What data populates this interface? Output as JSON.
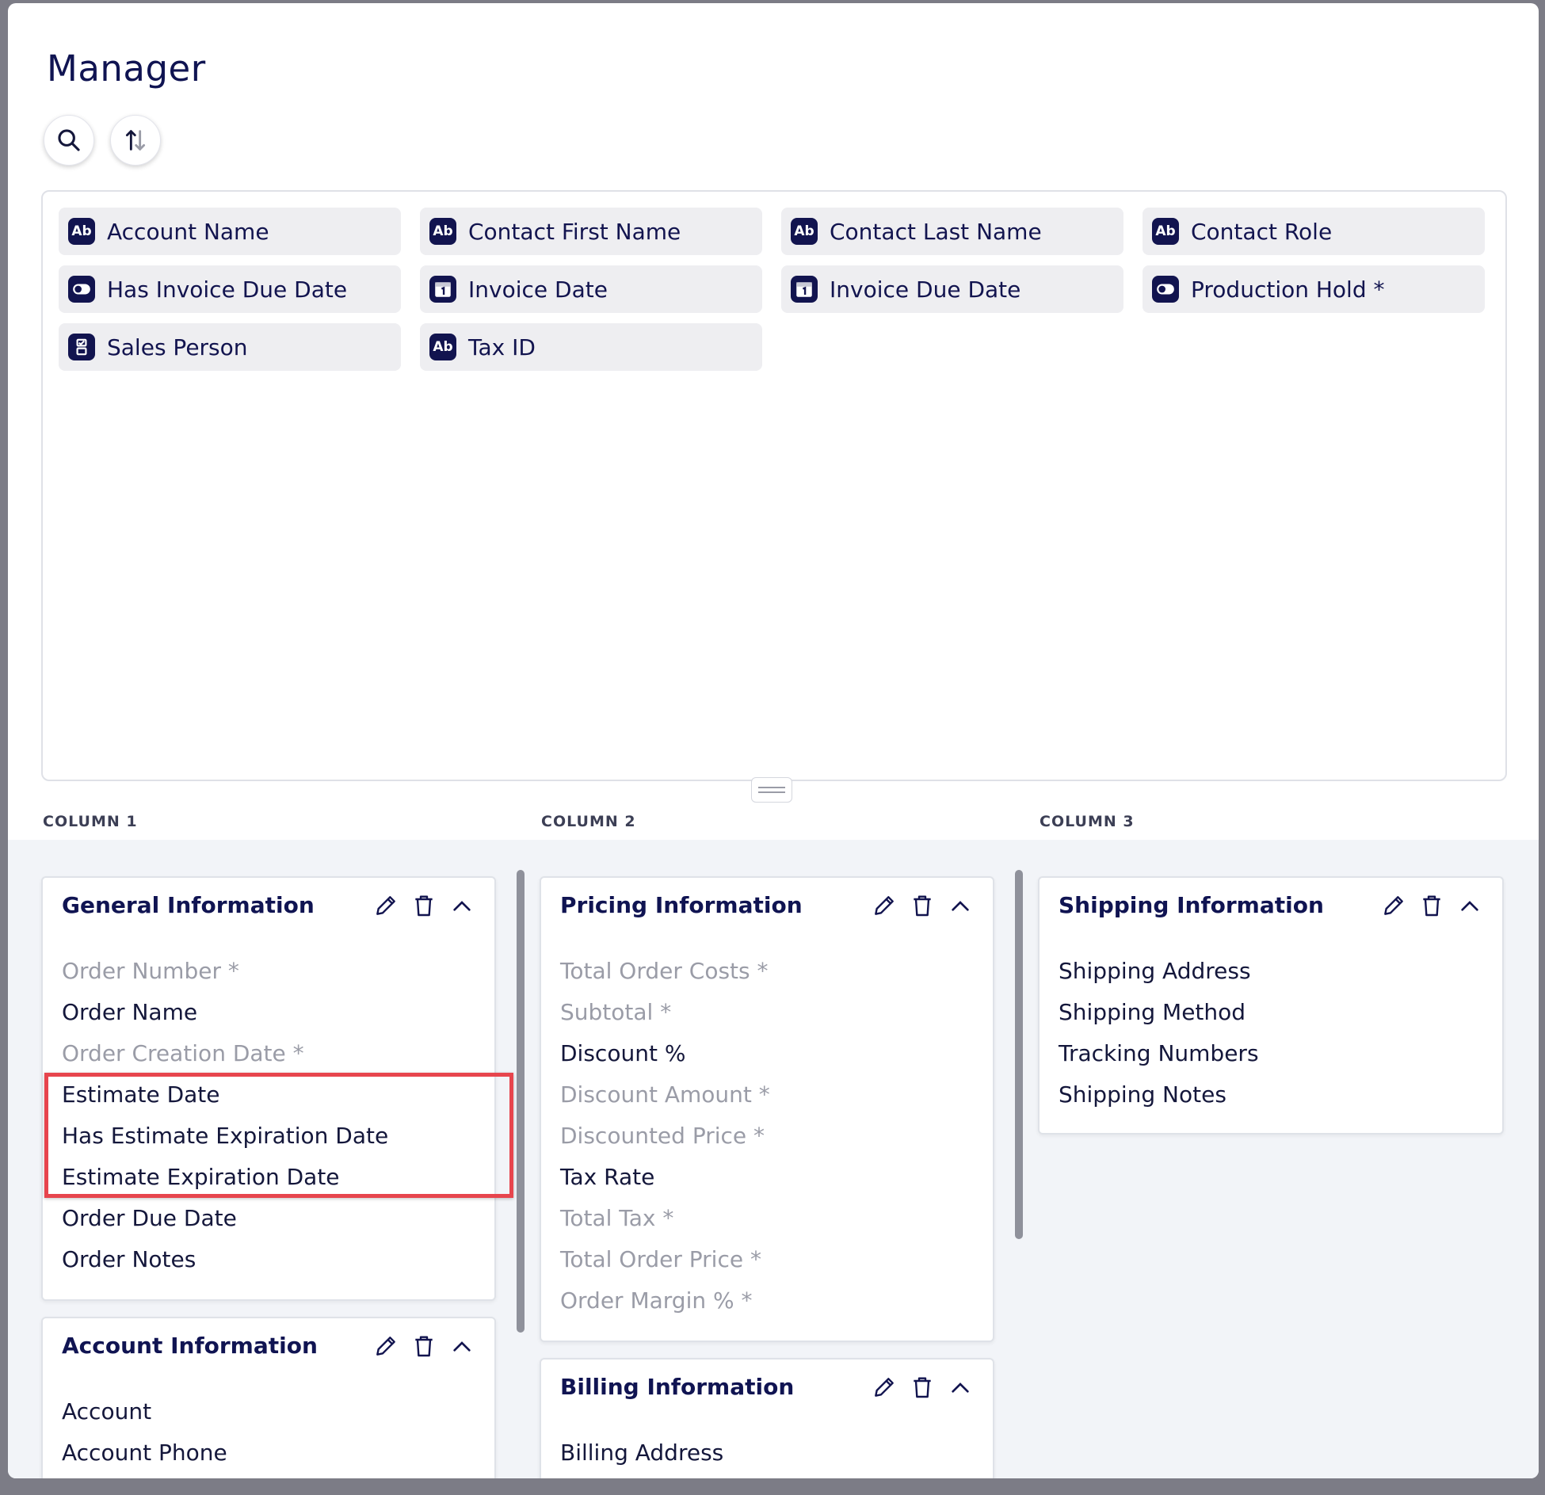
{
  "app": {
    "title": "Manager"
  },
  "toolbar": {
    "search_icon": "search-icon",
    "sort_icon": "sort-arrows-icon"
  },
  "available_fields": [
    {
      "label": "Account Name",
      "icon": "text-type-icon",
      "icon_text": "Ab"
    },
    {
      "label": "Contact First Name",
      "icon": "text-type-icon",
      "icon_text": "Ab"
    },
    {
      "label": "Contact Last Name",
      "icon": "text-type-icon",
      "icon_text": "Ab"
    },
    {
      "label": "Contact Role",
      "icon": "text-type-icon",
      "icon_text": "Ab"
    },
    {
      "label": "Has Invoice Due Date",
      "icon": "toggle-type-icon"
    },
    {
      "label": "Invoice Date",
      "icon": "date-type-icon"
    },
    {
      "label": "Invoice Due Date",
      "icon": "date-type-icon"
    },
    {
      "label": "Production Hold *",
      "icon": "toggle-type-icon"
    },
    {
      "label": "Sales Person",
      "icon": "select-type-icon"
    },
    {
      "label": "Tax ID",
      "icon": "text-type-icon",
      "icon_text": "Ab"
    }
  ],
  "columns": [
    {
      "label": "COLUMN 1"
    },
    {
      "label": "COLUMN 2"
    },
    {
      "label": "COLUMN 3"
    }
  ],
  "sections": {
    "general": {
      "title": "General Information",
      "fields": [
        {
          "label": "Order Number *",
          "muted": true
        },
        {
          "label": "Order Name",
          "muted": false
        },
        {
          "label": "Order Creation Date *",
          "muted": true
        },
        {
          "label": "Estimate Date",
          "muted": false
        },
        {
          "label": "Has Estimate Expiration Date",
          "muted": false
        },
        {
          "label": "Estimate Expiration Date",
          "muted": false
        },
        {
          "label": "Order Due Date",
          "muted": false
        },
        {
          "label": "Order Notes",
          "muted": false
        }
      ]
    },
    "account": {
      "title": "Account Information",
      "fields": [
        {
          "label": "Account",
          "muted": false
        },
        {
          "label": "Account Phone",
          "muted": false
        }
      ]
    },
    "pricing": {
      "title": "Pricing Information",
      "fields": [
        {
          "label": "Total Order Costs *",
          "muted": true
        },
        {
          "label": "Subtotal *",
          "muted": true
        },
        {
          "label": "Discount %",
          "muted": false
        },
        {
          "label": "Discount Amount *",
          "muted": true
        },
        {
          "label": "Discounted Price *",
          "muted": true
        },
        {
          "label": "Tax Rate",
          "muted": false
        },
        {
          "label": "Total Tax *",
          "muted": true
        },
        {
          "label": "Total Order Price *",
          "muted": true
        },
        {
          "label": "Order Margin % *",
          "muted": true
        }
      ]
    },
    "billing": {
      "title": "Billing Information",
      "fields": [
        {
          "label": "Billing Address",
          "muted": false
        }
      ]
    },
    "shipping": {
      "title": "Shipping Information",
      "fields": [
        {
          "label": "Shipping Address",
          "muted": false
        },
        {
          "label": "Shipping Method",
          "muted": false
        },
        {
          "label": "Tracking Numbers",
          "muted": false
        },
        {
          "label": "Shipping Notes",
          "muted": false
        }
      ]
    }
  },
  "section_actions": [
    "edit-pencil-icon",
    "delete-trash-icon",
    "collapse-chevron-up-icon"
  ],
  "colors": {
    "brand_navy": "#12144f",
    "chip_bg": "#eeeef1",
    "muted_text": "#9a9ca7",
    "highlight_red": "#e7454d",
    "columns_bg": "#f2f4f8"
  }
}
